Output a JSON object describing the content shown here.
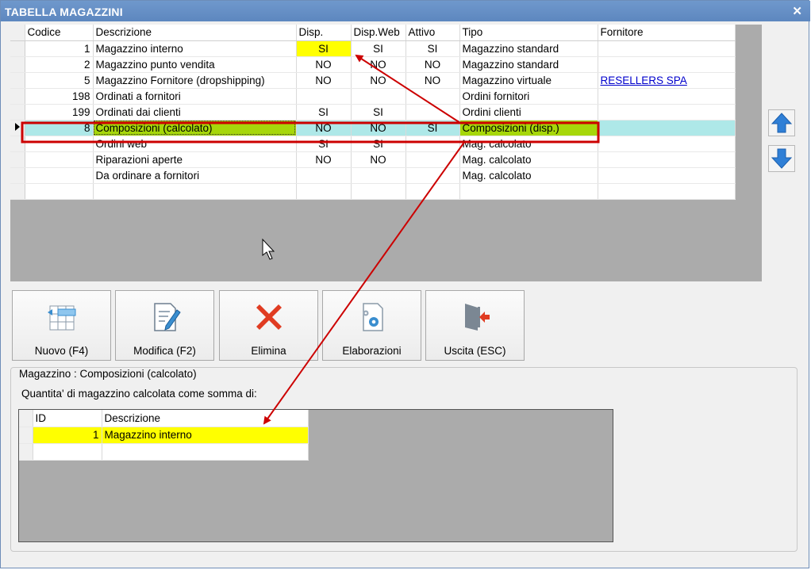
{
  "window": {
    "title": "TABELLA MAGAZZINI",
    "close_symbol": "✕"
  },
  "grid": {
    "columns": [
      "Codice",
      "Descrizione",
      "Disp.",
      "Disp.Web",
      "Attivo",
      "Tipo",
      "Fornitore"
    ],
    "rows": [
      {
        "codice": "1",
        "descrizione": "Magazzino interno",
        "disp": "SI",
        "disp_web": "SI",
        "attivo": "SI",
        "tipo": "Magazzino standard",
        "fornitore": ""
      },
      {
        "codice": "2",
        "descrizione": "Magazzino punto vendita",
        "disp": "NO",
        "disp_web": "NO",
        "attivo": "NO",
        "tipo": "Magazzino standard",
        "fornitore": ""
      },
      {
        "codice": "5",
        "descrizione": "Magazzino Fornitore (dropshipping)",
        "disp": "NO",
        "disp_web": "NO",
        "attivo": "NO",
        "tipo": "Magazzino virtuale",
        "fornitore": "RESELLERS SPA"
      },
      {
        "codice": "198",
        "descrizione": "Ordinati a fornitori",
        "disp": "",
        "disp_web": "",
        "attivo": "",
        "tipo": "Ordini fornitori",
        "fornitore": ""
      },
      {
        "codice": "199",
        "descrizione": "Ordinati dai clienti",
        "disp": "SI",
        "disp_web": "SI",
        "attivo": "",
        "tipo": "Ordini clienti",
        "fornitore": ""
      },
      {
        "codice": "8",
        "descrizione": "Composizioni (calcolato)",
        "disp": "NO",
        "disp_web": "NO",
        "attivo": "SI",
        "tipo": "Composizioni (disp.)",
        "fornitore": ""
      },
      {
        "codice": "",
        "descrizione": "Ordini web",
        "disp": "SI",
        "disp_web": "SI",
        "attivo": "",
        "tipo": "Mag. calcolato",
        "fornitore": ""
      },
      {
        "codice": "",
        "descrizione": "Riparazioni aperte",
        "disp": "NO",
        "disp_web": "NO",
        "attivo": "",
        "tipo": "Mag. calcolato",
        "fornitore": ""
      },
      {
        "codice": "",
        "descrizione": "Da ordinare a fornitori",
        "disp": "",
        "disp_web": "",
        "attivo": "",
        "tipo": "Mag. calcolato",
        "fornitore": ""
      },
      {
        "codice": "",
        "descrizione": "",
        "disp": "",
        "disp_web": "",
        "attivo": "",
        "tipo": "",
        "fornitore": ""
      }
    ],
    "selected_index": 5
  },
  "side_buttons": {
    "up_icon": "arrow-up-icon",
    "down_icon": "arrow-down-icon"
  },
  "toolbar": {
    "buttons": [
      {
        "label": "Nuovo (F4)",
        "icon": "new-record-icon"
      },
      {
        "label": "Modifica (F2)",
        "icon": "edit-document-icon"
      },
      {
        "label": "Elimina",
        "icon": "delete-x-icon"
      },
      {
        "label": "Elaborazioni",
        "icon": "settings-document-icon"
      },
      {
        "label": "Uscita (ESC)",
        "icon": "exit-door-icon"
      }
    ]
  },
  "detail": {
    "legend": "Magazzino : Composizioni (calcolato)",
    "description": "Quantita' di magazzino calcolata come somma di:",
    "columns": [
      "ID",
      "Descrizione"
    ],
    "rows": [
      {
        "id": "1",
        "descrizione": "Magazzino interno"
      },
      {
        "id": "",
        "descrizione": ""
      }
    ]
  },
  "colors": {
    "title_bar": "#5d87bf",
    "selected_row": "#aee8e8",
    "highlight_green": "#a6d70a",
    "highlight_yellow": "#ffff00",
    "annotation_red": "#cc0000",
    "arrow_blue": "#2f7fd6"
  }
}
